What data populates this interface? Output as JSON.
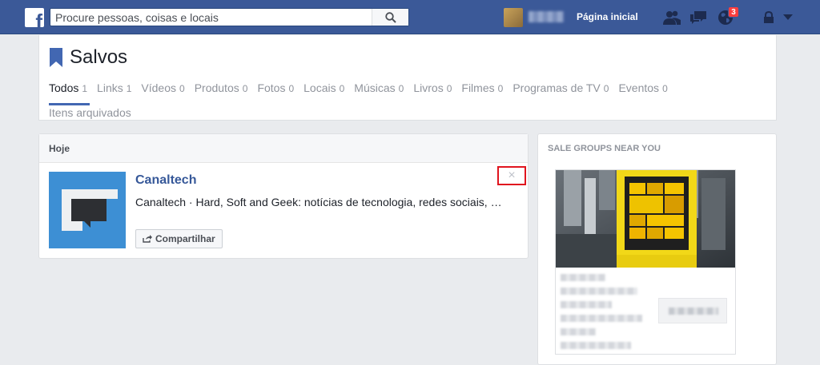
{
  "topbar": {
    "logo_letter": "f",
    "search_placeholder": "Procure pessoas, coisas e locais",
    "home_label": "Página inicial",
    "notification_count": "3"
  },
  "header": {
    "title": "Salvos",
    "tabs": [
      {
        "label": "Todos",
        "count": "1"
      },
      {
        "label": "Links",
        "count": "1"
      },
      {
        "label": "Vídeos",
        "count": "0"
      },
      {
        "label": "Produtos",
        "count": "0"
      },
      {
        "label": "Fotos",
        "count": "0"
      },
      {
        "label": "Locais",
        "count": "0"
      },
      {
        "label": "Músicas",
        "count": "0"
      },
      {
        "label": "Livros",
        "count": "0"
      },
      {
        "label": "Filmes",
        "count": "0"
      },
      {
        "label": "Programas de TV",
        "count": "0"
      },
      {
        "label": "Eventos",
        "count": "0"
      }
    ],
    "archived_label": "Itens arquivados"
  },
  "saved": {
    "section_label": "Hoje",
    "item": {
      "title": "Canaltech",
      "description": "Canaltech · Hard, Soft and Geek: notícias de tecnologia, redes sociais, internet, gadgets e muito mais",
      "share_label": "Compartilhar",
      "remove_label": "×"
    }
  },
  "sidebar": {
    "heading": "SALE GROUPS NEAR YOU"
  },
  "colors": {
    "brand_blue": "#3b5998",
    "accent_red": "#e0141e",
    "thumb_blue": "#3d8fd4"
  }
}
